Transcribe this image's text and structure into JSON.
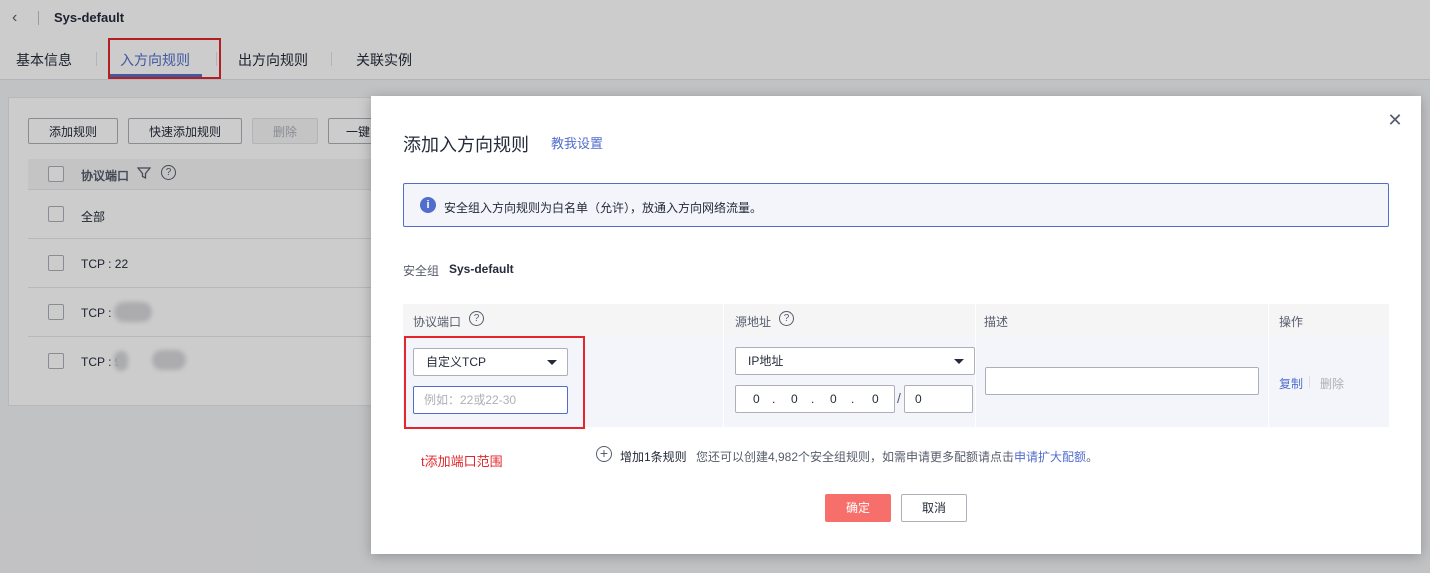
{
  "header": {
    "back_icon": "chevron-left-icon",
    "title": "Sys-default"
  },
  "tabs": [
    {
      "label": "基本信息"
    },
    {
      "label": "入方向规则",
      "active": true
    },
    {
      "label": "出方向规则"
    },
    {
      "label": "关联实例"
    }
  ],
  "toolbar": {
    "add_rule": "添加规则",
    "quick_add_rule": "快速添加规则",
    "delete": "删除",
    "more": "一键"
  },
  "list": {
    "col_protocol_port": "协议端口",
    "rows": [
      {
        "label": "全部"
      },
      {
        "label": "TCP : 22"
      },
      {
        "label": "TCP : "
      },
      {
        "label": "TCP : 9"
      }
    ]
  },
  "dialog": {
    "title": "添加入方向规则",
    "help_link": "教我设置",
    "info": "安全组入方向规则为白名单（允许），放通入方向网络流量。",
    "sg_label": "安全组",
    "sg_name": "Sys-default",
    "columns": {
      "protocol_port": "协议端口",
      "source": "源地址",
      "description": "描述",
      "actions": "操作"
    },
    "rule": {
      "protocol": "自定义TCP",
      "port_placeholder": "例如：22或22-30",
      "source_type": "IP地址",
      "ip": [
        "0",
        "0",
        "0",
        "0"
      ],
      "mask": "0",
      "description": "",
      "copy": "复制",
      "delete": "删除"
    },
    "add_more": "增加1条规则",
    "quota_tip": "您还可以创建4,982个安全组规则，如需申请更多配额请点击",
    "quota_link": "申请扩大配额",
    "quota_end": "。",
    "ok": "确定",
    "cancel": "取消"
  },
  "annotation": {
    "note": "t添加端口范围"
  },
  "colors": {
    "accent": "#526ecc",
    "danger": "#e2262c",
    "primary_btn": "#f66f6a"
  }
}
